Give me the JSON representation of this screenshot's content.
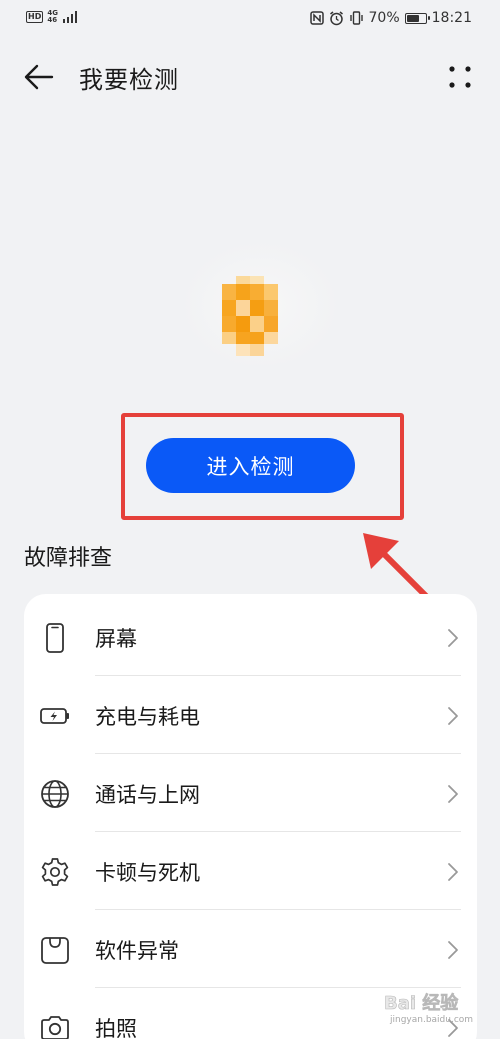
{
  "status_bar": {
    "left_badge": "HD",
    "network_top": "4G",
    "network_bottom": "46",
    "battery": "70%",
    "battery_level": 0.7,
    "time": "18:21"
  },
  "app_bar": {
    "title": "我要检测",
    "back_icon": "back-arrow-icon",
    "more_icon": "more-dots-icon"
  },
  "main": {
    "cta_label": "进入检测",
    "section_title": "故障排查",
    "items": [
      {
        "label": "屏幕",
        "icon": "phone-screen-icon"
      },
      {
        "label": "充电与耗电",
        "icon": "battery-charging-icon"
      },
      {
        "label": "通话与上网",
        "icon": "globe-icon"
      },
      {
        "label": "卡顿与死机",
        "icon": "gear-icon"
      },
      {
        "label": "软件异常",
        "icon": "app-store-bag-icon"
      },
      {
        "label": "拍照",
        "icon": "camera-icon"
      }
    ]
  },
  "watermark": {
    "text": "Bai 经验",
    "sub": "jingyan.baidu.com"
  },
  "colors": {
    "accent": "#0a59f7",
    "annotation": "#e5403a",
    "background": "#f1f2f4"
  }
}
